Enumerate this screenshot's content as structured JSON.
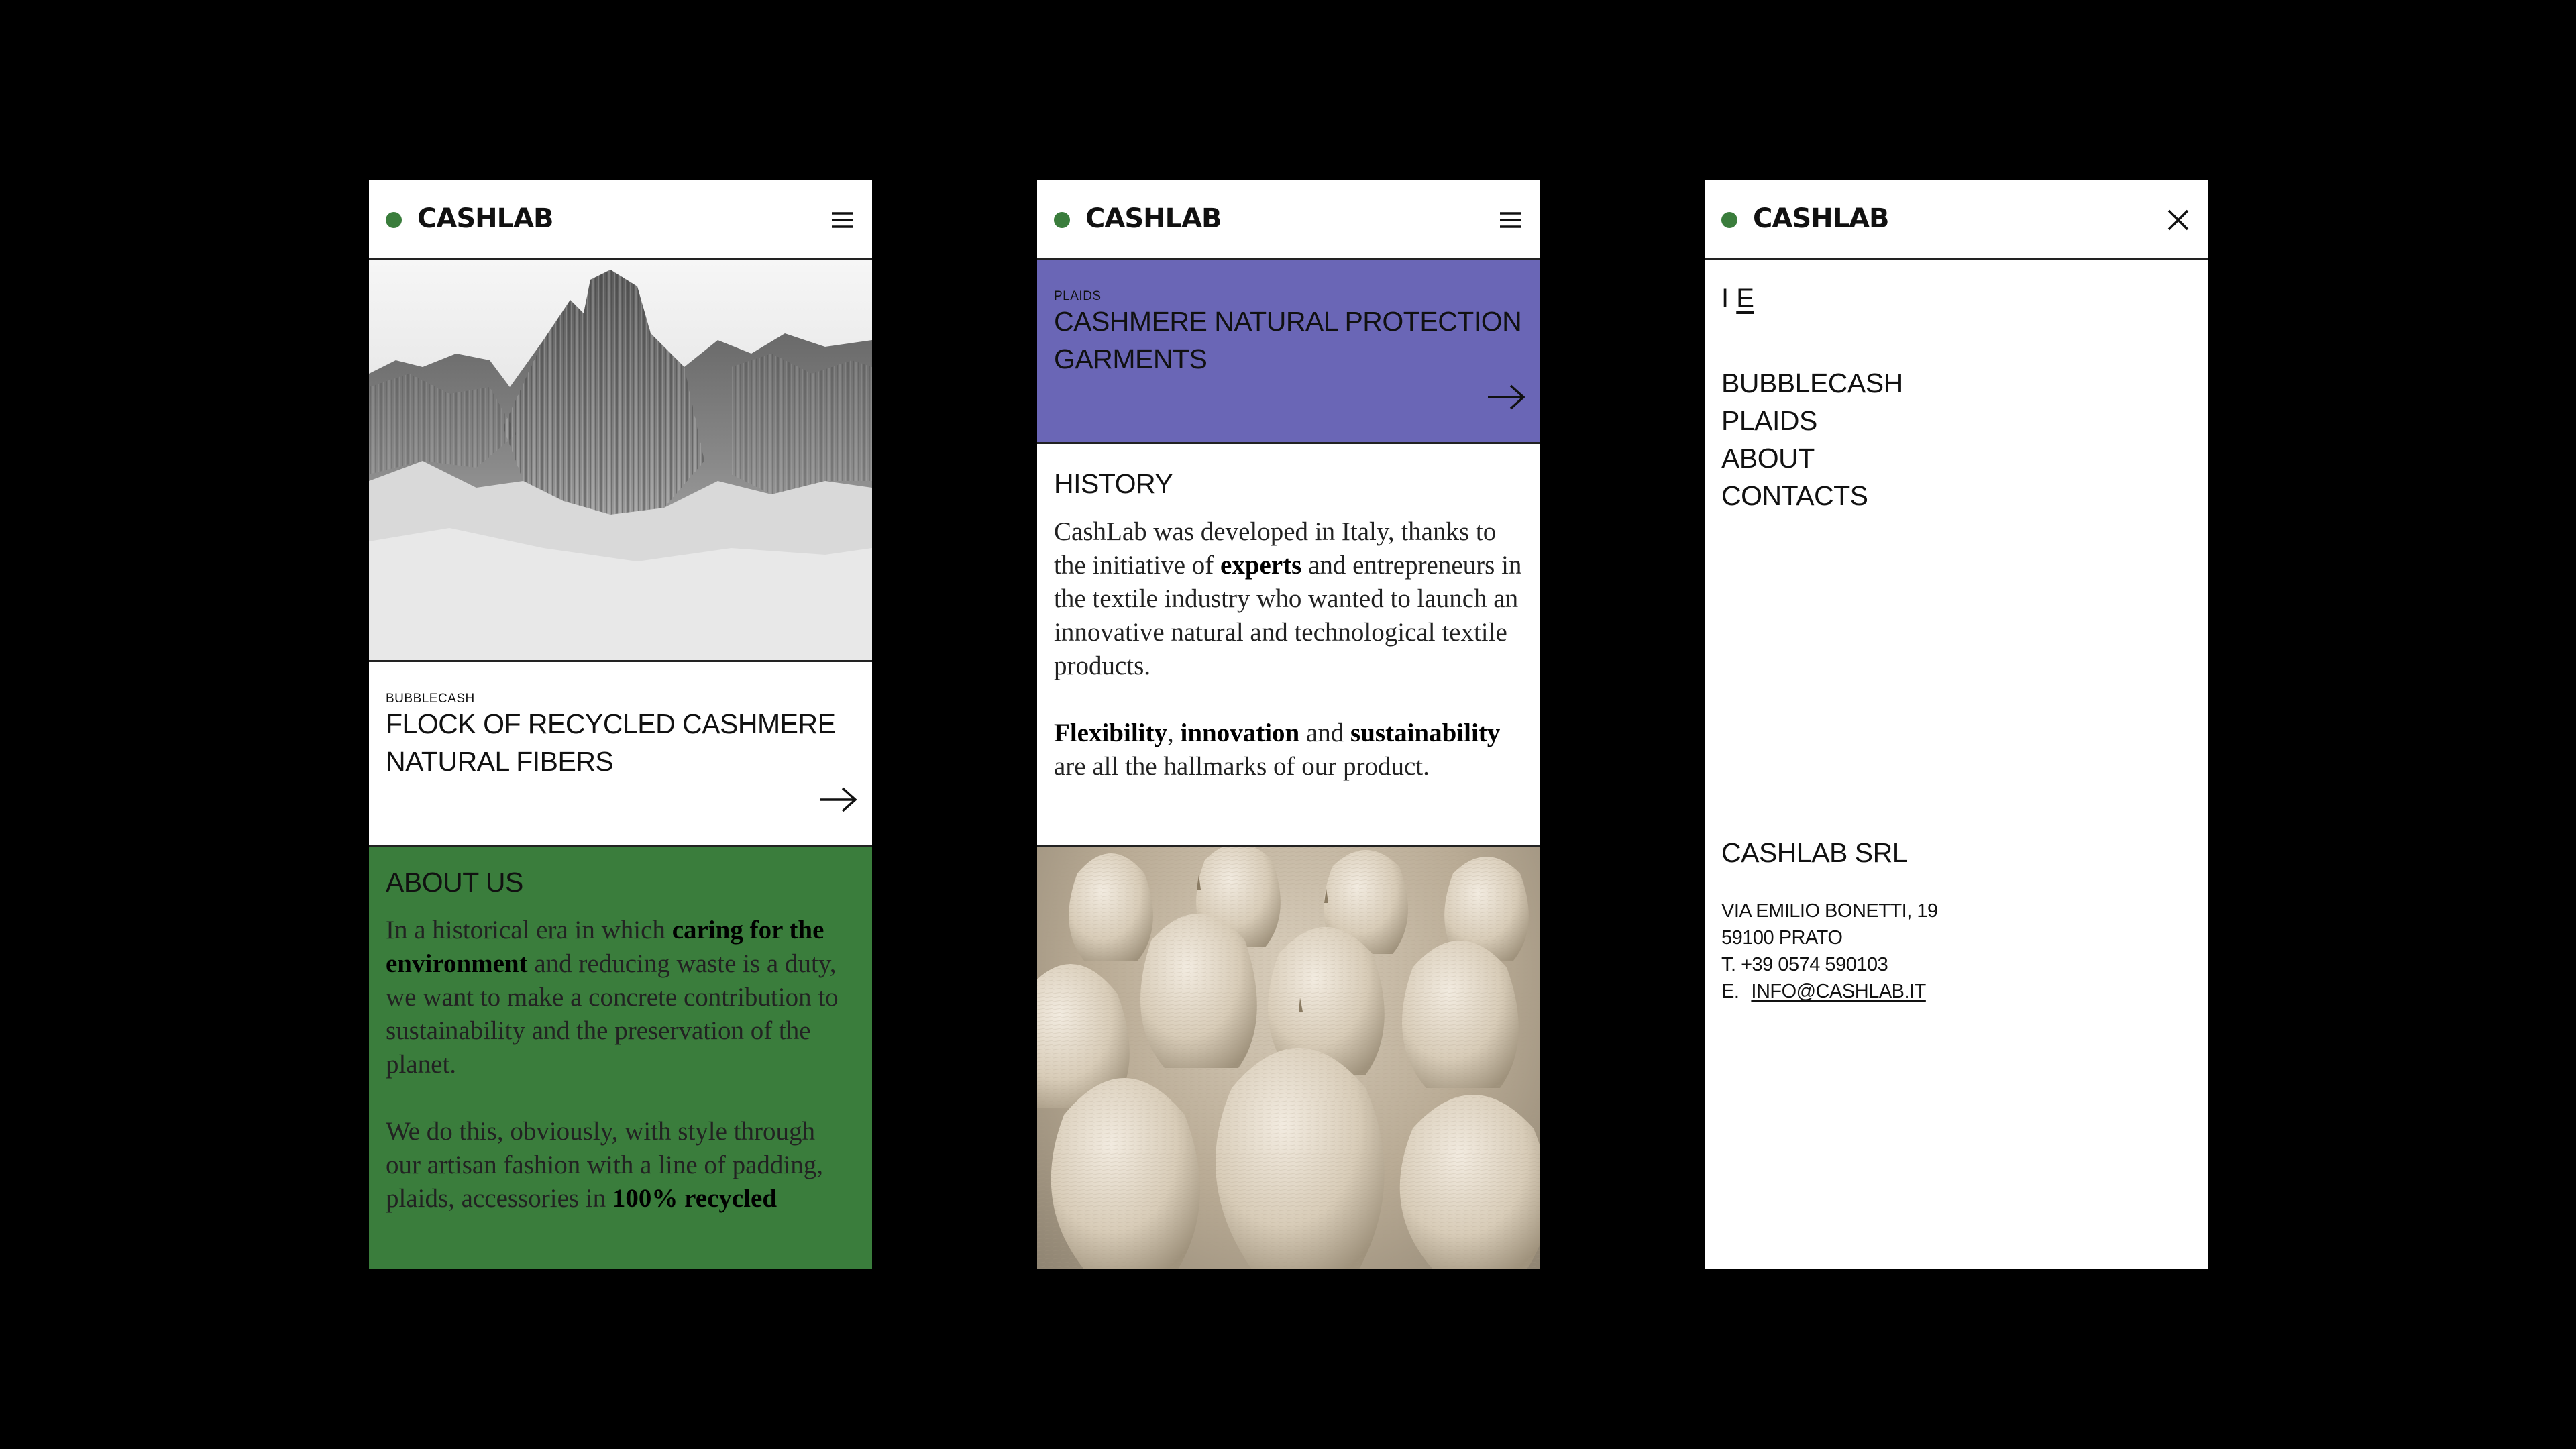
{
  "colors": {
    "brand_dot": "#3a7d3c",
    "about_bg": "#3a7d3c",
    "plaid_bg": "#6a66b6",
    "background": "#000000"
  },
  "brand": {
    "name": "CASHLAB"
  },
  "icons": {
    "menu": "hamburger-icon",
    "close": "close-icon",
    "arrow": "arrow-right-icon"
  },
  "screen1": {
    "card": {
      "kicker": "BUBBLECASH",
      "title_line1": "FLOCK OF RECYCLED CASHMERE",
      "title_line2": "NATURAL FIBERS"
    },
    "about": {
      "title": "ABOUT US",
      "p1_a": "In a historical era in which ",
      "p1_b": "caring for the environment",
      "p1_c": " and reducing waste is a duty, we want to make a concrete contribution to sustainability and the preservation of the planet.",
      "p2_a": "We do this, obviously, with style through our artisan fashion with a line of padding, plaids,  accessories in ",
      "p2_b": "100% recycled"
    }
  },
  "screen2": {
    "card": {
      "kicker": "PLAIDS",
      "title_line1": "CASHMERE NATURAL PROTECTION",
      "title_line2": "GARMENTS"
    },
    "history": {
      "title": "HISTORY",
      "p1_a": "CashLab was developed in Italy, thanks to the initiative of ",
      "p1_b": "experts",
      "p1_c": " and entrepreneurs in the textile industry who wanted to launch an innovative natural and technological textile products.",
      "p2_a": "Flexibility",
      "p2_b": ", ",
      "p2_c": "innovation",
      "p2_d": " and ",
      "p2_e": "sustainability",
      "p2_f": " are all the hallmarks of our product."
    }
  },
  "screen3": {
    "lang": {
      "it": "I",
      "en": "E"
    },
    "nav": [
      "BUBBLECASH",
      "PLAIDS",
      "ABOUT",
      "CONTACTS"
    ],
    "company": "CASHLAB SRL",
    "address": {
      "street": "VIA EMILIO BONETTI, 19",
      "city": "59100 PRATO",
      "phone": "T. +39 0574 590103",
      "email_prefix": "E.",
      "email": "INFO@CASHLAB.IT"
    }
  }
}
